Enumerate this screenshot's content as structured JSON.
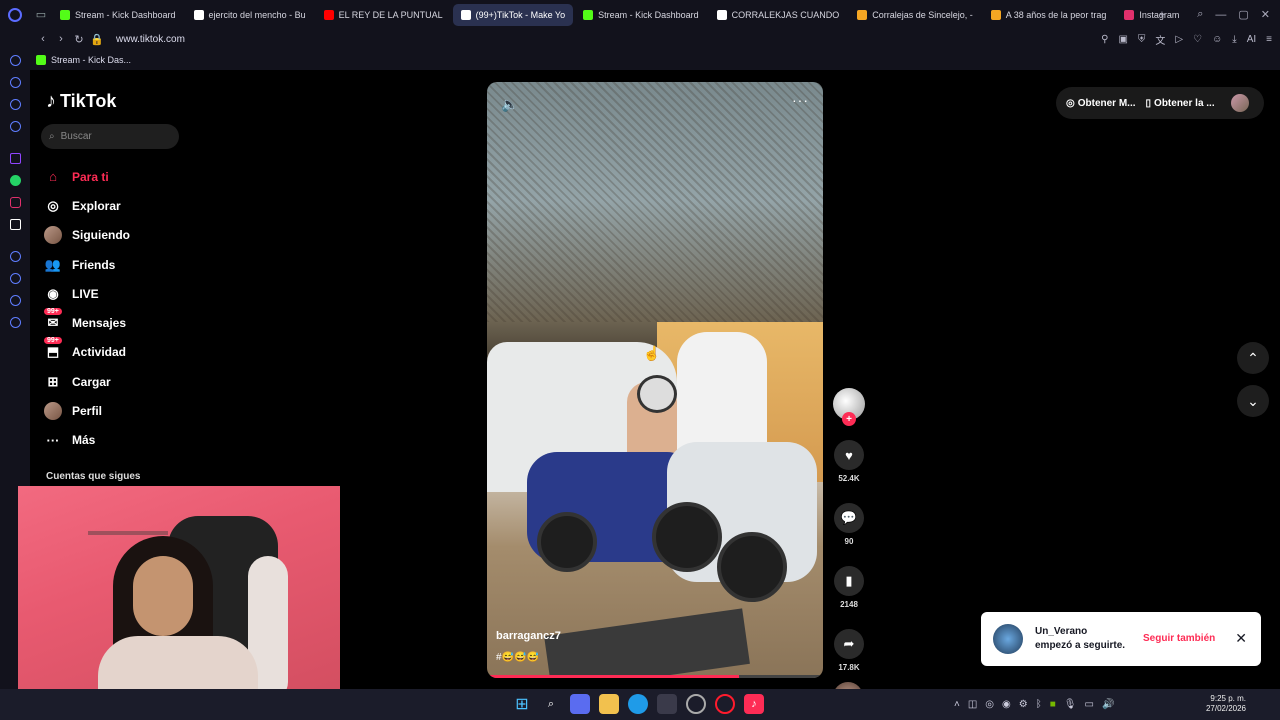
{
  "browser": {
    "tabs": [
      {
        "label": "Stream - Kick Dashboard",
        "color": "#53fc18"
      },
      {
        "label": "ejercito del mencho - Bu",
        "color": "#ffffff"
      },
      {
        "label": "EL REY DE LA PUNTUAL",
        "color": "#ff0000"
      },
      {
        "label": "(99+)TikTok - Make Yo",
        "color": "#ffffff",
        "active": true
      },
      {
        "label": "Stream - Kick Dashboard",
        "color": "#53fc18"
      },
      {
        "label": "CORRALEKJAS CUANDO",
        "color": "#ffffff"
      },
      {
        "label": "Corralejas de Sincelejo, -",
        "color": "#f5a623"
      },
      {
        "label": "A 38 años de la peor trag",
        "color": "#f5a623"
      },
      {
        "label": "Instagram",
        "color": "#e1306c"
      }
    ],
    "url": "www.tiktok.com",
    "bookmark": "Stream - Kick Das...",
    "ai_label": "AI"
  },
  "tiktok": {
    "logo_text": "TikTok",
    "search_placeholder": "Buscar",
    "menu": [
      {
        "label": "Para ti",
        "icon": "home-icon"
      },
      {
        "label": "Explorar",
        "icon": "compass-icon"
      },
      {
        "label": "Siguiendo",
        "icon": "following-avatar"
      },
      {
        "label": "Friends",
        "icon": "friends-icon"
      },
      {
        "label": "LIVE",
        "icon": "live-icon"
      },
      {
        "label": "Mensajes",
        "icon": "messages-icon",
        "badge": "99+"
      },
      {
        "label": "Actividad",
        "icon": "activity-icon",
        "badge": "99+"
      },
      {
        "label": "Cargar",
        "icon": "upload-icon"
      },
      {
        "label": "Perfil",
        "icon": "profile-avatar"
      },
      {
        "label": "Más",
        "icon": "more-icon"
      }
    ],
    "following_heading": "Cuentas que sigues",
    "top_right": {
      "item1": "Obtener M...",
      "item2": "Obtener la ..."
    },
    "video": {
      "username": "barragancz7",
      "tags": "#😅😅😅",
      "progress": 0.75
    },
    "actions": {
      "likes": "52.4K",
      "comments": "90",
      "saves": "2148",
      "shares": "17.8K"
    },
    "toast": {
      "name": "Un_Verano",
      "message": "empezó a seguirte.",
      "action": "Seguir también"
    },
    "accent": "#fe2c55"
  },
  "taskbar": {
    "time": "9:25 p. m.",
    "date": "27/02/2026"
  }
}
